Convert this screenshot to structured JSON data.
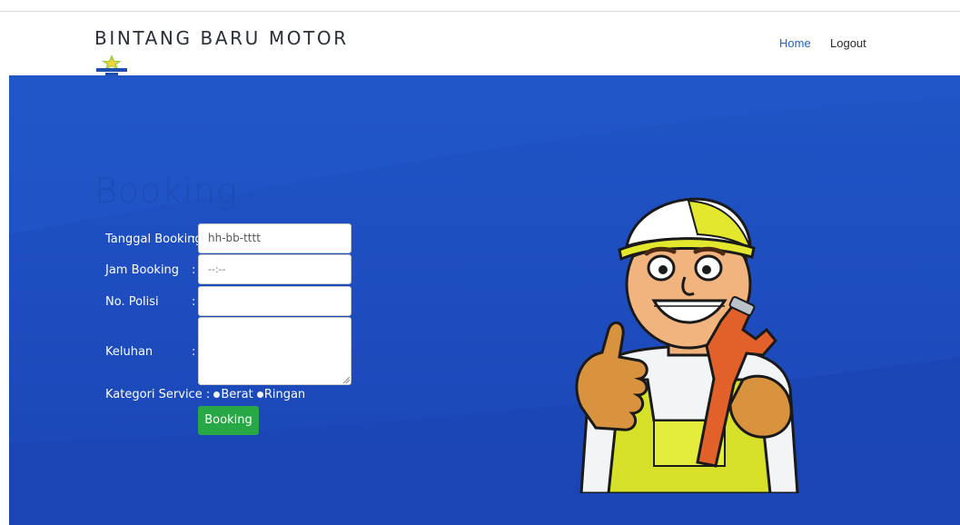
{
  "header": {
    "brand": "BINTANG BARU MOTOR",
    "logo_text": "BINTANG BARU MOTOR",
    "nav": [
      {
        "label": "Home"
      },
      {
        "label": "Logout"
      }
    ]
  },
  "booking": {
    "title": "Booking",
    "fields": [
      {
        "label": "Tanggal Booking",
        "colon": ":",
        "value": "hh-bb-tttt"
      },
      {
        "label": "Jam Booking",
        "colon": ":",
        "value": "--:--"
      },
      {
        "label": "No. Polisi",
        "colon": ":",
        "value": ""
      },
      {
        "label": "Keluhan",
        "colon": ":",
        "value": ""
      }
    ],
    "kategori": {
      "label": "Kategori Service :",
      "options": [
        {
          "label": "Berat"
        },
        {
          "label": "Ringan"
        }
      ]
    },
    "submit_label": "Booking"
  },
  "colors": {
    "hero": "#1f55c6",
    "button": "#28a745",
    "nav_active": "#1f63c6"
  }
}
